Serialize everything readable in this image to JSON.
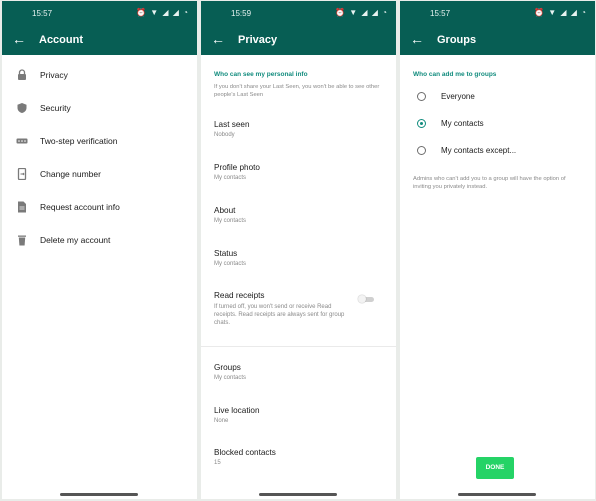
{
  "colors": {
    "header": "#075e54",
    "accent": "#128c7e",
    "done": "#25d366"
  },
  "account_screen": {
    "status_time": "15:57",
    "title": "Account",
    "items": [
      {
        "label": "Privacy",
        "icon": "lock-icon"
      },
      {
        "label": "Security",
        "icon": "shield-icon"
      },
      {
        "label": "Two-step verification",
        "icon": "dots-icon"
      },
      {
        "label": "Change number",
        "icon": "phone-change-icon"
      },
      {
        "label": "Request account info",
        "icon": "document-icon"
      },
      {
        "label": "Delete my account",
        "icon": "trash-icon"
      }
    ]
  },
  "privacy_screen": {
    "status_time": "15:59",
    "title": "Privacy",
    "section_header": "Who can see my personal info",
    "section_note": "If you don't share your Last Seen, you won't be able to see other people's Last Seen",
    "items": [
      {
        "title": "Last seen",
        "value": "Nobody"
      },
      {
        "title": "Profile photo",
        "value": "My contacts"
      },
      {
        "title": "About",
        "value": "My contacts"
      },
      {
        "title": "Status",
        "value": "My contacts"
      }
    ],
    "read_receipts": {
      "title": "Read receipts",
      "description": "If turned off, you won't send or receive Read receipts. Read receipts are always sent for group chats.",
      "enabled": false
    },
    "more_items": [
      {
        "title": "Groups",
        "value": "My contacts"
      },
      {
        "title": "Live location",
        "value": "None"
      },
      {
        "title": "Blocked contacts",
        "value": "15"
      }
    ]
  },
  "groups_screen": {
    "status_time": "15:57",
    "title": "Groups",
    "section_header": "Who can add me to groups",
    "options": [
      {
        "label": "Everyone",
        "selected": false
      },
      {
        "label": "My contacts",
        "selected": true
      },
      {
        "label": "My contacts except...",
        "selected": false
      }
    ],
    "note": "Admins who can't add you to a group will have the option of inviting you privately instead.",
    "done_label": "DONE"
  }
}
